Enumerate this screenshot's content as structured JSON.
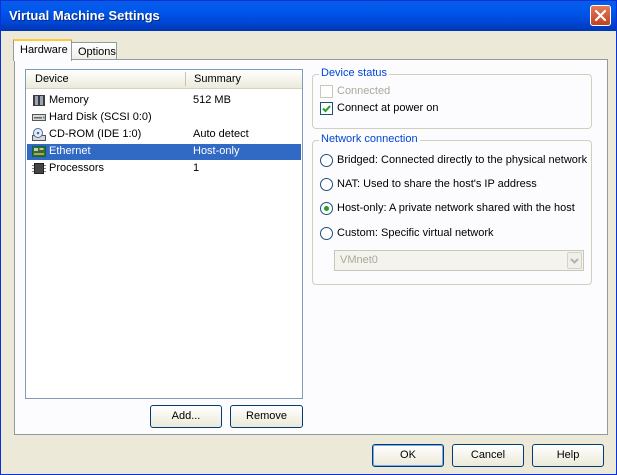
{
  "window": {
    "title": "Virtual Machine Settings"
  },
  "tabs": [
    {
      "label": "Hardware",
      "active": true
    },
    {
      "label": "Options",
      "active": false
    }
  ],
  "device_list": {
    "columns": [
      "Device",
      "Summary"
    ],
    "rows": [
      {
        "device": "Memory",
        "summary": "512 MB",
        "icon": "memory-icon",
        "selected": false
      },
      {
        "device": "Hard Disk (SCSI 0:0)",
        "summary": "",
        "icon": "hard-disk-icon",
        "selected": false
      },
      {
        "device": "CD-ROM (IDE 1:0)",
        "summary": "Auto detect",
        "icon": "cdrom-icon",
        "selected": false
      },
      {
        "device": "Ethernet",
        "summary": "Host-only",
        "icon": "network-card-icon",
        "selected": true
      },
      {
        "device": "Processors",
        "summary": "1",
        "icon": "processor-icon",
        "selected": false
      }
    ]
  },
  "list_buttons": {
    "add": "Add...",
    "remove": "Remove"
  },
  "device_status": {
    "title": "Device status",
    "connected": {
      "label": "Connected",
      "checked": false,
      "enabled": false
    },
    "connect_at_power_on": {
      "label": "Connect at power on",
      "checked": true,
      "enabled": true
    }
  },
  "network_connection": {
    "title": "Network connection",
    "options": [
      {
        "label": "Bridged: Connected directly to the physical network",
        "selected": false
      },
      {
        "label": "NAT: Used to share the host's IP address",
        "selected": false
      },
      {
        "label": "Host-only: A private network shared with the host",
        "selected": true
      },
      {
        "label": "Custom: Specific virtual network",
        "selected": false
      }
    ],
    "custom_network": {
      "value": "VMnet0",
      "enabled": false
    }
  },
  "dialog_buttons": {
    "ok": "OK",
    "cancel": "Cancel",
    "help": "Help"
  },
  "colors": {
    "titlebar": "#0054e3",
    "selection": "#316ac5",
    "group_title": "#0046d5",
    "dialog_bg": "#ece9d8"
  }
}
